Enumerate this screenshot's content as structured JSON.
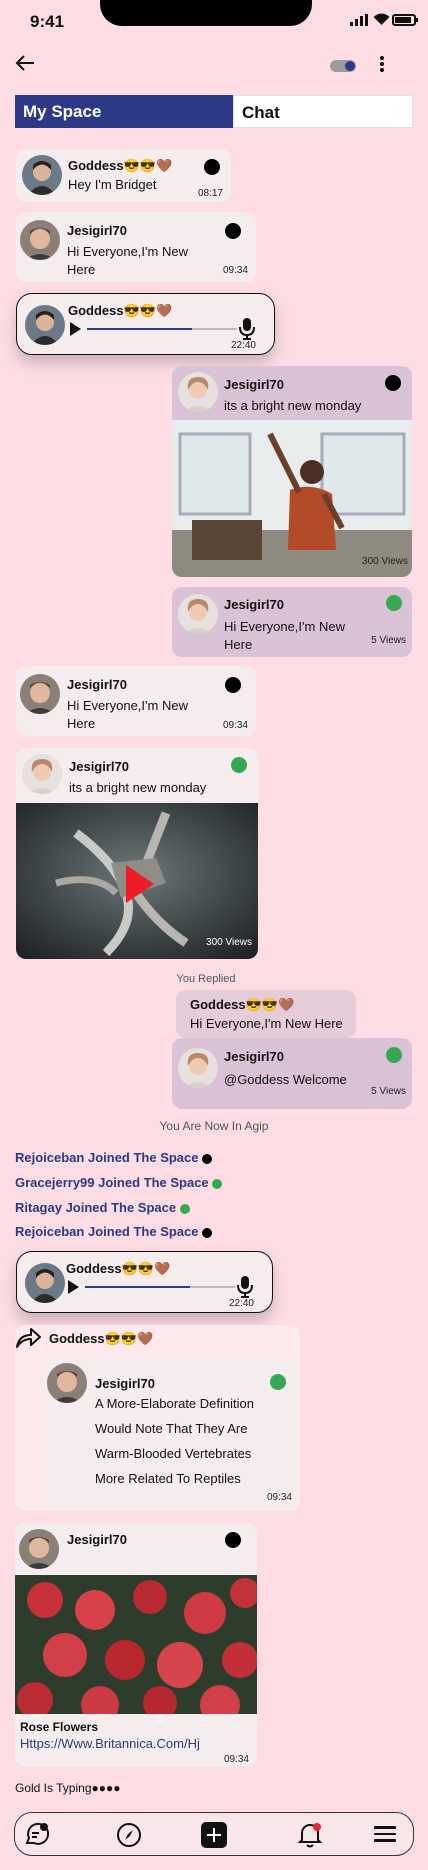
{
  "status_bar": {
    "time": "9:41"
  },
  "tabs": {
    "my_space": "My Space",
    "chat": "Chat"
  },
  "messages": {
    "m1": {
      "name": "Goddess😎😎🤎",
      "text": "Hey I'm Bridget",
      "time": "08:17"
    },
    "m2": {
      "name": "Jesigirl70",
      "text1": "Hi Everyone,I'm New",
      "text2": "Here",
      "time": "09:34"
    },
    "m3": {
      "name": "Goddess😎😎🤎",
      "time": "22:40",
      "progress": 0.7
    },
    "m4": {
      "name": "Jesigirl70",
      "text": "its a bright new monday",
      "views": "300 Views"
    },
    "m5": {
      "name": "Jesigirl70",
      "text1": "Hi Everyone,I'm New",
      "text2": "Here",
      "views": "5 Views"
    },
    "m6": {
      "name": "Jesigirl70",
      "text1": "Hi Everyone,I'm New",
      "text2": "Here",
      "time": "09:34"
    },
    "m7": {
      "name": "Jesigirl70",
      "text": "its a bright new monday",
      "views": "300 Views"
    },
    "m8": {
      "replied_label": "You Replied",
      "quote_name": "Goddess😎😎🤎",
      "quote_text": "Hi Everyone,I'm New Here",
      "name": "Jesigirl70",
      "text": "@Goddess Welcome",
      "views": "5 Views"
    },
    "m9": {
      "name": "Goddess😎😎🤎",
      "time": "22:40",
      "progress": 0.7
    },
    "m10": {
      "forwarder": "Goddess😎😎🤎",
      "name": "Jesigirl70",
      "lines": [
        "A More-Elaborate Definition",
        "Would Note That They Are",
        "Warm-Blooded Vertebrates",
        "More Related To Reptiles"
      ],
      "time": "09:34"
    },
    "m11": {
      "name": "Jesigirl70",
      "title": "Rose Flowers",
      "link": "Https://Www.Britannica.Com/Hj",
      "time": "09:34"
    }
  },
  "system_note": "You Are Now In Agip",
  "joins": [
    {
      "text": "Rejoiceban Joined The Space",
      "dot": "#000000"
    },
    {
      "text": "Gracejerry99 Joined The Space",
      "dot": "#34a853"
    },
    {
      "text": "Ritagay Joined The Space",
      "dot": "#34a853"
    },
    {
      "text": "Rejoiceban Joined The Space",
      "dot": "#000000"
    }
  ],
  "typing": "Gold Is Typing●●●●",
  "colors": {
    "accent": "#2b3987",
    "online": "#34a853",
    "background": "#fddde3"
  },
  "bottom_nav": [
    "chat-icon",
    "compass-icon",
    "add-icon",
    "bell-icon",
    "menu-icon"
  ]
}
